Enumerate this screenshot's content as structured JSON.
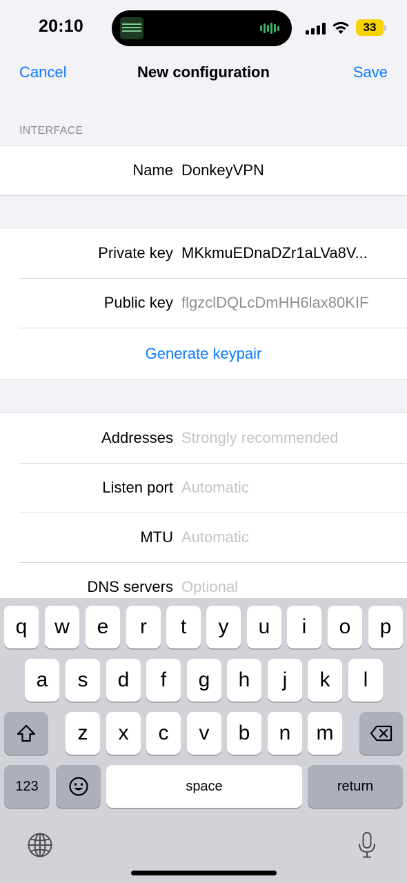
{
  "status_bar": {
    "time": "20:10",
    "battery": "33",
    "battery_color": "#f7d100",
    "icons": [
      "signal-icon",
      "wifi-icon",
      "battery-icon"
    ]
  },
  "nav": {
    "cancel": "Cancel",
    "title": "New configuration",
    "save": "Save",
    "accent": "#0a7aff"
  },
  "interface_header": "INTERFACE",
  "interface": {
    "name_label": "Name",
    "name_value": "DonkeyVPN",
    "private_key_label": "Private key",
    "private_key_value": "MKkmuEDnaDZr1aLVa8V...",
    "public_key_label": "Public key",
    "public_key_value": "flgzclDQLcDmHH6lax80KIF",
    "generate_keypair": "Generate keypair",
    "addresses_label": "Addresses",
    "addresses_placeholder": "Strongly recommended",
    "listen_port_label": "Listen port",
    "listen_port_placeholder": "Automatic",
    "mtu_label": "MTU",
    "mtu_placeholder": "Automatic",
    "dns_label": "DNS servers",
    "dns_placeholder": "Optional"
  },
  "keyboard": {
    "row1": [
      "q",
      "w",
      "e",
      "r",
      "t",
      "y",
      "u",
      "i",
      "o",
      "p"
    ],
    "row2": [
      "a",
      "s",
      "d",
      "f",
      "g",
      "h",
      "j",
      "k",
      "l"
    ],
    "row3": [
      "z",
      "x",
      "c",
      "v",
      "b",
      "n",
      "m"
    ],
    "numbers": "123",
    "space": "space",
    "return": "return",
    "icons": [
      "shift-icon",
      "backspace-icon",
      "emoji-icon",
      "globe-icon",
      "microphone-icon"
    ]
  }
}
